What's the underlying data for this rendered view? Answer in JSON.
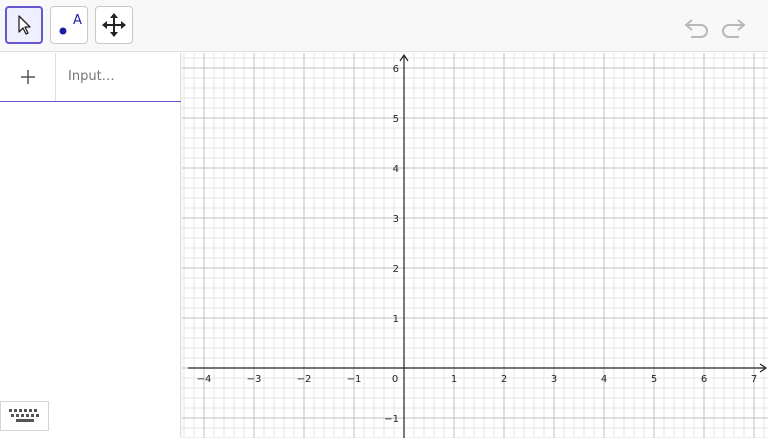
{
  "toolbar": {
    "tools": [
      {
        "name": "move-tool",
        "icon": "cursor-arrow-icon",
        "active": true
      },
      {
        "name": "point-tool",
        "icon": "point-a-icon",
        "label": "A",
        "active": false
      },
      {
        "name": "move-graphics-tool",
        "icon": "move-arrows-icon",
        "active": false
      }
    ],
    "undo_icon": "undo-icon",
    "redo_icon": "redo-icon"
  },
  "algebra": {
    "add_icon": "plus-icon",
    "input_placeholder": "Input…",
    "keyboard_icon": "keyboard-icon"
  },
  "graphics": {
    "x_axis": {
      "min": -4,
      "max": 7,
      "tick_labels": [
        "−4",
        "−3",
        "−2",
        "−1",
        "0",
        "1",
        "2",
        "3",
        "4",
        "5",
        "6",
        "7"
      ]
    },
    "y_axis": {
      "min": -1,
      "max": 6,
      "tick_labels": [
        "−1",
        "1",
        "2",
        "3",
        "4",
        "5",
        "6"
      ]
    },
    "grid": true,
    "colors": {
      "major_grid": "#c0c0c0",
      "minor_grid": "#e6e6e6",
      "axis": "#222222",
      "accent": "#6557d2"
    }
  }
}
